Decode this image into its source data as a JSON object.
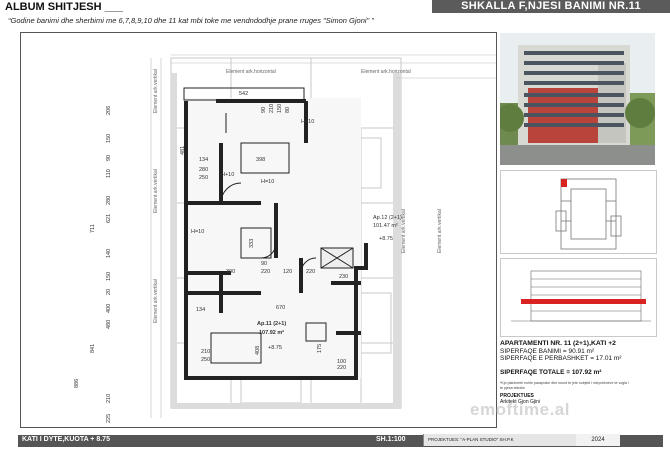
{
  "header": {
    "album": "ALBUM SHITJESH",
    "title": "SHKALLA F,NJESI BANIMI NR.11",
    "subtitle": "“Godine banimi dhe sherbimi me 6,7,8,9,10 dhe 11 kat mbi toke me vendndodhje prane rruges \"Simon Gjoni\" ”"
  },
  "plan": {
    "element_labels": {
      "ark_horizontal": "Element ark.horizontal",
      "ark_vertikal": "Element ark.vertikal"
    },
    "apartment_11": {
      "name": "Ap.11 (2+1)",
      "area": "107.92 m²",
      "level": "+8.75"
    },
    "apartment_12": {
      "name": "Ap.12 (2+1)",
      "area": "101.47 m²",
      "level": "+8.75"
    },
    "dims_top": [
      "542",
      "90",
      "210",
      "150",
      "80"
    ],
    "dims_left": [
      "206",
      "150",
      "90",
      "110",
      "280",
      "621",
      "711",
      "140",
      "150",
      "20",
      "400",
      "480",
      "841",
      "886",
      "210",
      "225"
    ],
    "dims_inner": [
      "481",
      "134",
      "280",
      "250",
      "398",
      "H+10",
      "H=10",
      "333",
      "390",
      "90",
      "220",
      "120",
      "220",
      "230",
      "134",
      "670",
      "408",
      "210",
      "250",
      "175",
      "100",
      "220",
      "H+10",
      "H=10"
    ]
  },
  "panel": {
    "apartment_title": "APARTAMENTI NR. 11 (2+1),KATI +2",
    "area_living": "SIPERFAQE BANIMI = 90.91 m²",
    "area_common": "SIPERFAQE E PERBASHKET = 17.01 m²",
    "area_total": "SIPERFAQE TOTALE = 107.92 m²",
    "note": "*Kjo planimetri eshte paraprake dhe mund te jete subjekt i ndryshimeve te vogla / te pjesa teknike",
    "stamp1": "PROJEKTUES",
    "stamp2": "Arkitekt Gjon Gjini"
  },
  "footer": {
    "floor_level": "KATI I DYTE,KUOTA + 8.75",
    "scale": "SH.1:100",
    "project": "PROJEKTUES: \"A-PLAN STUDIO\" SH.P.K",
    "year": "2024"
  },
  "watermark": "emoftime.al"
}
